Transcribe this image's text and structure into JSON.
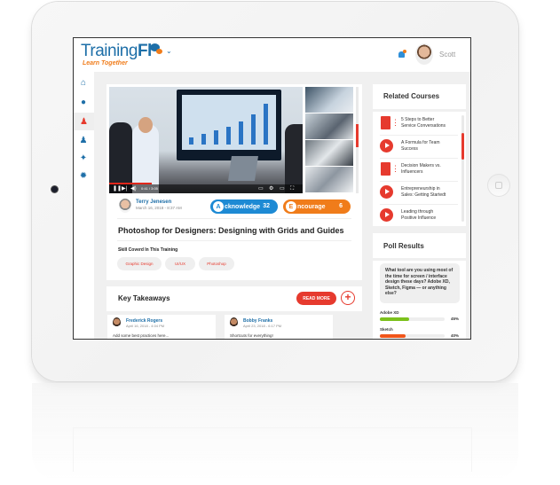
{
  "app": {
    "logo_text_light": "Training",
    "logo_text_bold": "Fl",
    "tagline": "Learn Together",
    "logo_menu_icon": "chevron-down-icon"
  },
  "header": {
    "notification_icon": "bell-icon",
    "user_name": "Scott"
  },
  "sidebar": {
    "items": [
      {
        "icon": "home-icon",
        "glyph": "⌂",
        "active": false
      },
      {
        "icon": "chat-icon",
        "glyph": "●",
        "active": false
      },
      {
        "icon": "user-feedback-icon",
        "glyph": "♟",
        "active": true
      },
      {
        "icon": "user-icon",
        "glyph": "♟",
        "active": false
      },
      {
        "icon": "support-icon",
        "glyph": "✦",
        "active": false
      },
      {
        "icon": "settings-icon",
        "glyph": "✹",
        "active": false
      }
    ]
  },
  "video": {
    "progress_percent": 22,
    "controls": {
      "play_pause": "❚❚",
      "next": "▶|",
      "volume": "◀)",
      "time": "0:41 / 3:05",
      "captions": "▭",
      "settings": "⚙",
      "theater": "▭",
      "fullscreen": "⛶"
    }
  },
  "post": {
    "author_name": "Terry Jenesen",
    "author_date": "March 16, 2018 - 8:37 AM",
    "acknowledge": {
      "letter": "A",
      "label": "cknowledge",
      "count": "32"
    },
    "encourage": {
      "letter": "E",
      "label": "ncourage",
      "count": "6"
    },
    "title": "Photoshop for Designers: Designing with Grids and Guides",
    "skills_heading": "Skill Coverd In This Training",
    "skills": [
      "Graphic Design",
      "UI/UX",
      "Photoshop"
    ]
  },
  "key_takeaways": {
    "title": "Key Takeaways",
    "read_more": "READ MORE",
    "add_label": "+",
    "notes": [
      {
        "name": "Frederick Rogers",
        "date": "April 16, 2018 - 4:04 PM",
        "body": "Add some best practices here..."
      },
      {
        "name": "Bobby Franks",
        "date": "April 23, 2018 - 6:17 PM",
        "body": "Shortcuts for everything!"
      }
    ]
  },
  "related_courses": {
    "title": "Related Courses",
    "items": [
      {
        "type": "pdf",
        "icon": "pdf-icon",
        "line1": "5 Steps to Better",
        "line2": "Service Conversations"
      },
      {
        "type": "video",
        "icon": "play-icon",
        "line1": "A Formula for Team",
        "line2": "Success"
      },
      {
        "type": "pdf",
        "icon": "pdf-icon",
        "line1": "Decision Makers vs.",
        "line2": "Influencers"
      },
      {
        "type": "video",
        "icon": "play-icon",
        "line1": "Entrepreneurship in",
        "line2": "Sales: Getting Startedt"
      },
      {
        "type": "video",
        "icon": "play-icon",
        "line1": "Leading through",
        "line2": "Positive Influence"
      }
    ]
  },
  "poll": {
    "title": "Poll Results",
    "question": "What tool are you using most of the time for screen / interface design these days? Adobe XD, Sketch, Figma — or anything else?",
    "options": [
      {
        "label": "Adobe XD",
        "percent": 45,
        "percent_label": "45%",
        "color": "#7cc11c"
      },
      {
        "label": "Sketch",
        "percent": 40,
        "percent_label": "40%",
        "color": "#f0551a"
      }
    ]
  },
  "colors": {
    "brand_blue": "#1e6fa8",
    "accent_red": "#e63a2e",
    "acknowledge_blue": "#1d8ad4",
    "encourage_orange": "#f07c1a"
  }
}
